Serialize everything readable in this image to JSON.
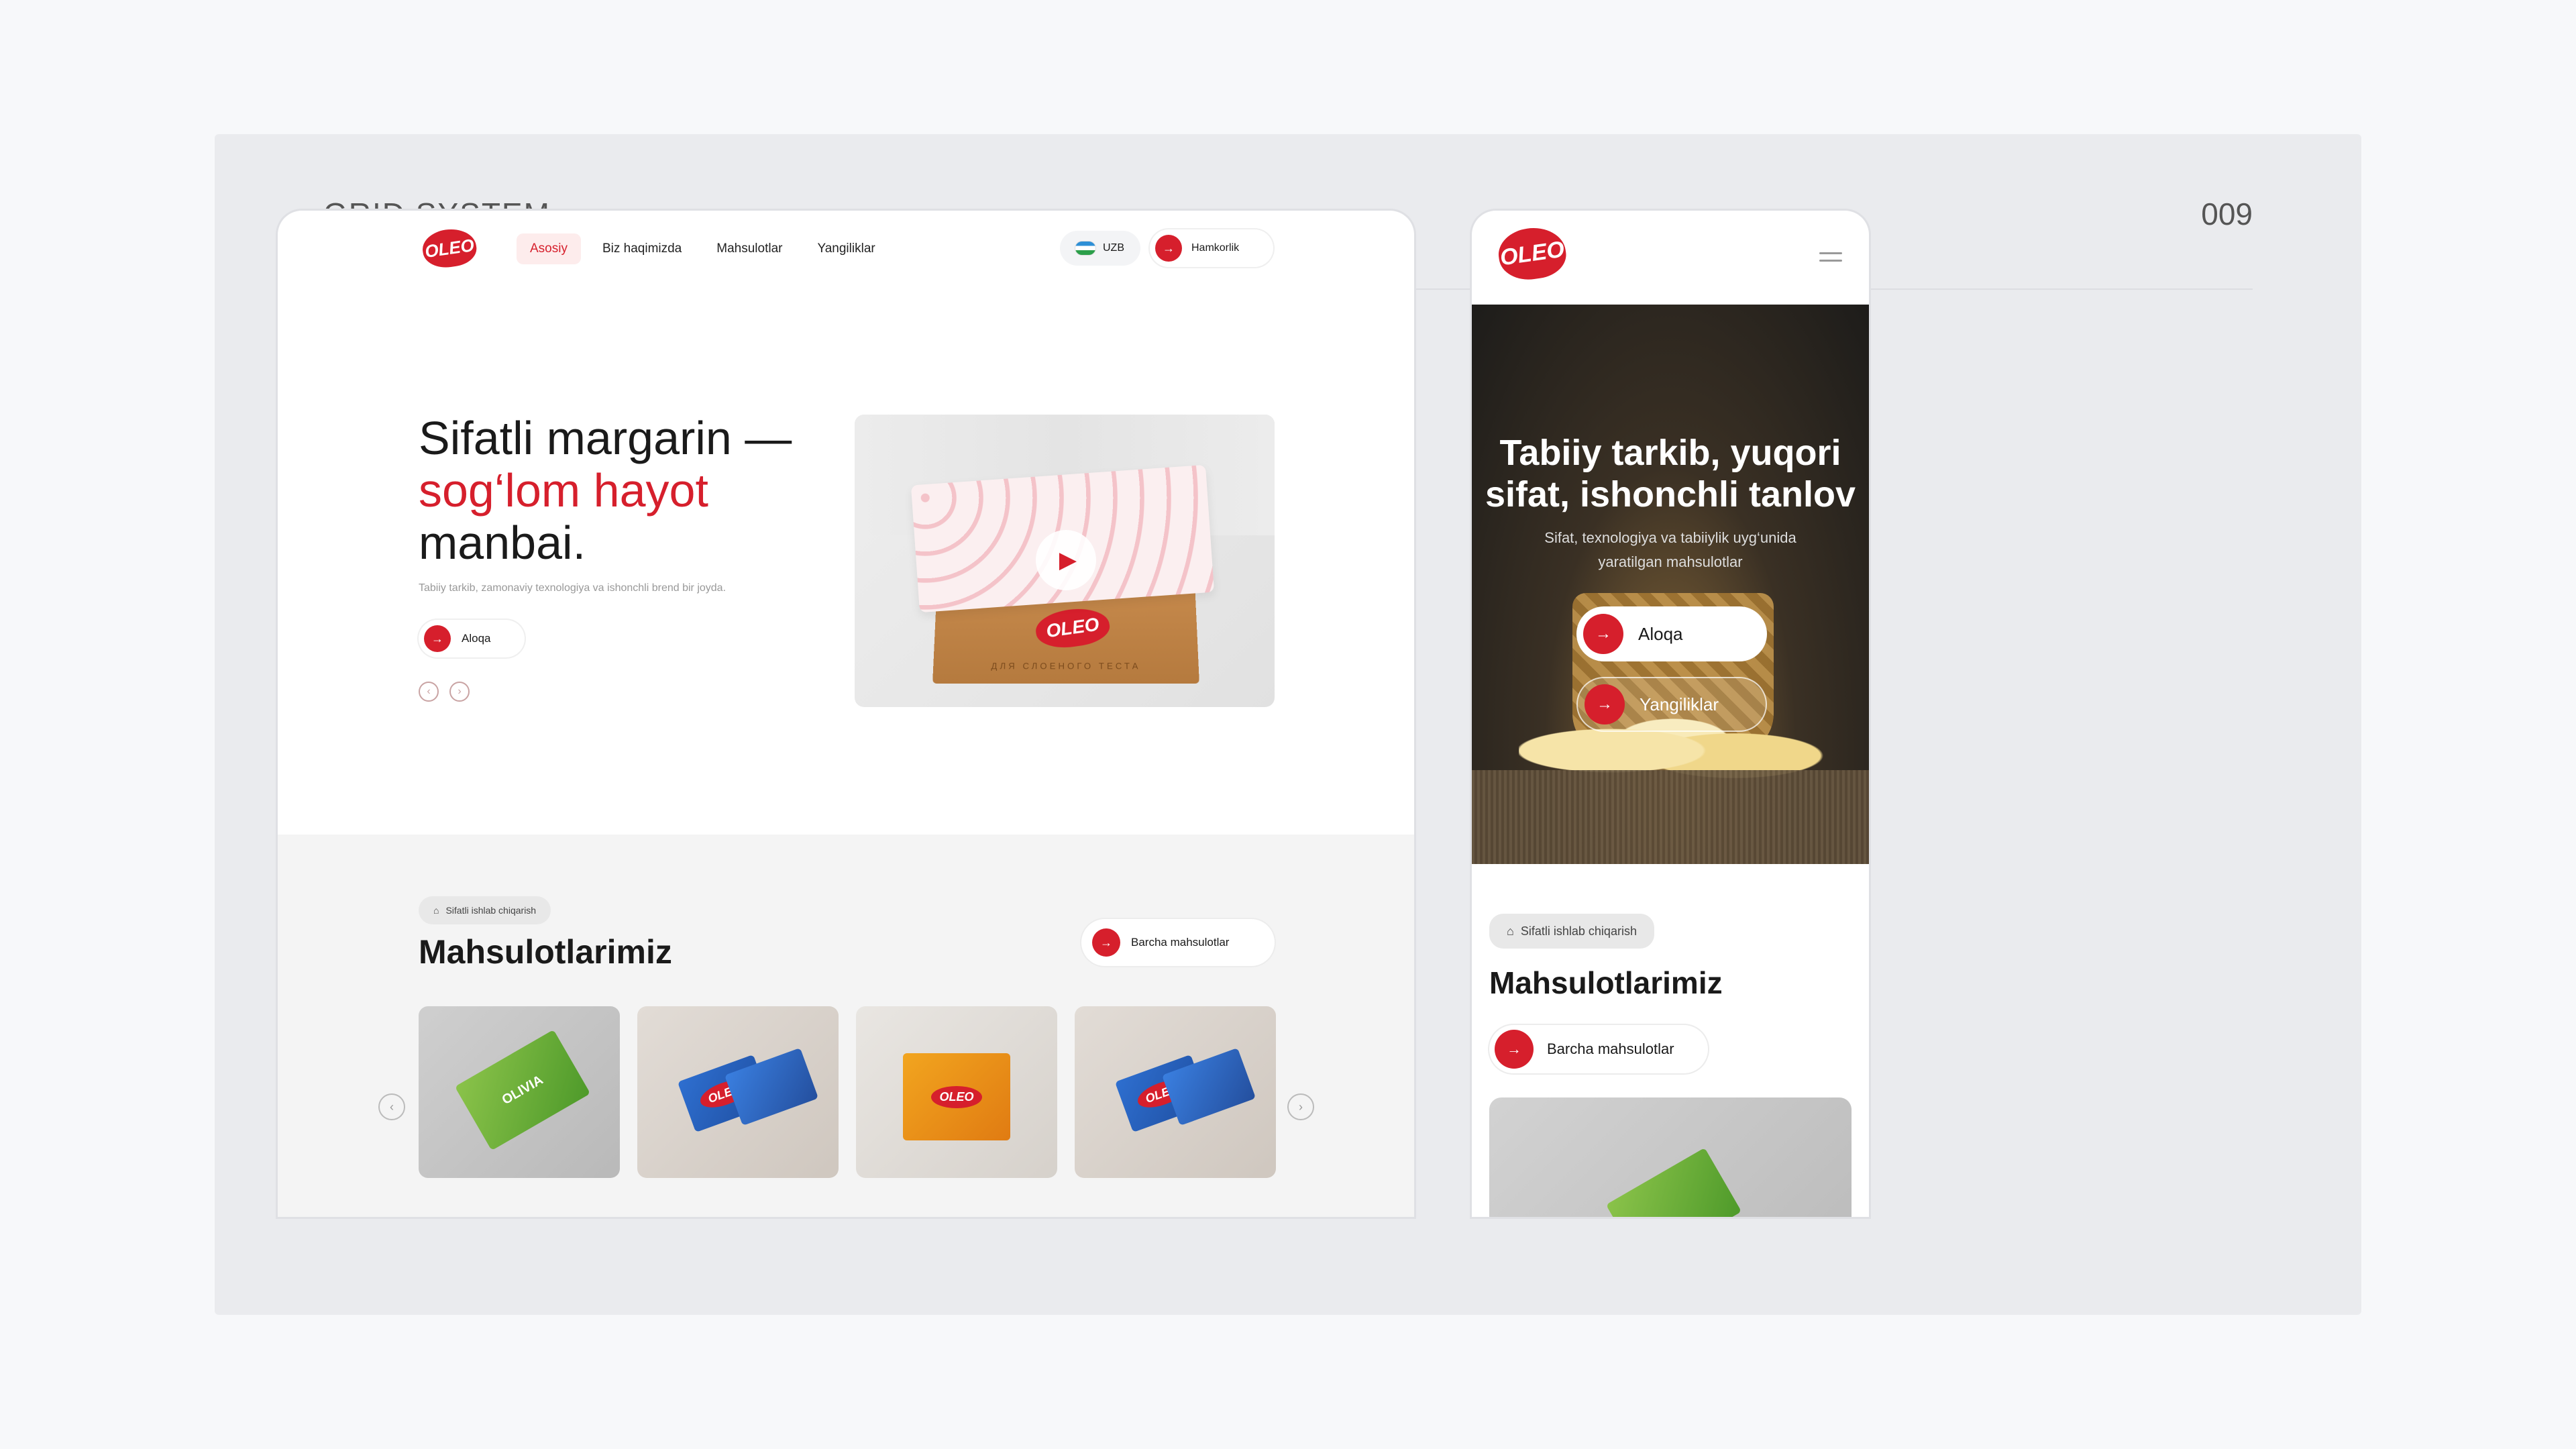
{
  "board": {
    "title": "GRID SYSTEM",
    "number": "009"
  },
  "desktop": {
    "logo": "OLEO",
    "nav": [
      "Asosiy",
      "Biz haqimizda",
      "Mahsulotlar",
      "Yangiliklar"
    ],
    "lang": "UZB",
    "partner_button": "Hamkorlik",
    "hero": {
      "title_line1": "Sifatli margarin —",
      "title_line2": "sog‘lom hayot",
      "title_line3": "manbai.",
      "subtitle": "Tabiiy tarkib, zamonaviy texnologiya va ishonchli brend bir joyda.",
      "button": "Aloqa",
      "media_logo": "OLEO",
      "media_box_text": "ДЛЯ СЛОЕНОГО ТЕСТА"
    },
    "products": {
      "chip": "Sifatli ishlab chiqarish",
      "heading": "Mahsulotlarimiz",
      "all_button": "Barcha mahsulotlar",
      "cards": [
        {
          "brand": "OLIVIA"
        },
        {
          "brand": "OLEO"
        },
        {
          "brand": "OLEO"
        },
        {
          "brand": "OLEO"
        }
      ]
    }
  },
  "mobile": {
    "logo": "OLEO",
    "hero": {
      "title": "Tabiiy tarkib, yuqori sifat, ishonchli tanlov",
      "subtitle": "Sifat, texnologiya va tabiiylik uyg‘unida yaratilgan mahsulotlar",
      "button1": "Aloqa",
      "button2": "Yangiliklar"
    },
    "products": {
      "chip": "Sifatli ishlab chiqarish",
      "heading": "Mahsulotlarimiz",
      "all_button": "Barcha mahsulotlar"
    }
  },
  "colors": {
    "accent": "#d61f2c",
    "board": "#eaebee",
    "page": "#f7f8fa"
  },
  "icons": {
    "arrow": "→",
    "prev": "‹",
    "next": "›",
    "play": "▶",
    "bag": "🛍"
  }
}
